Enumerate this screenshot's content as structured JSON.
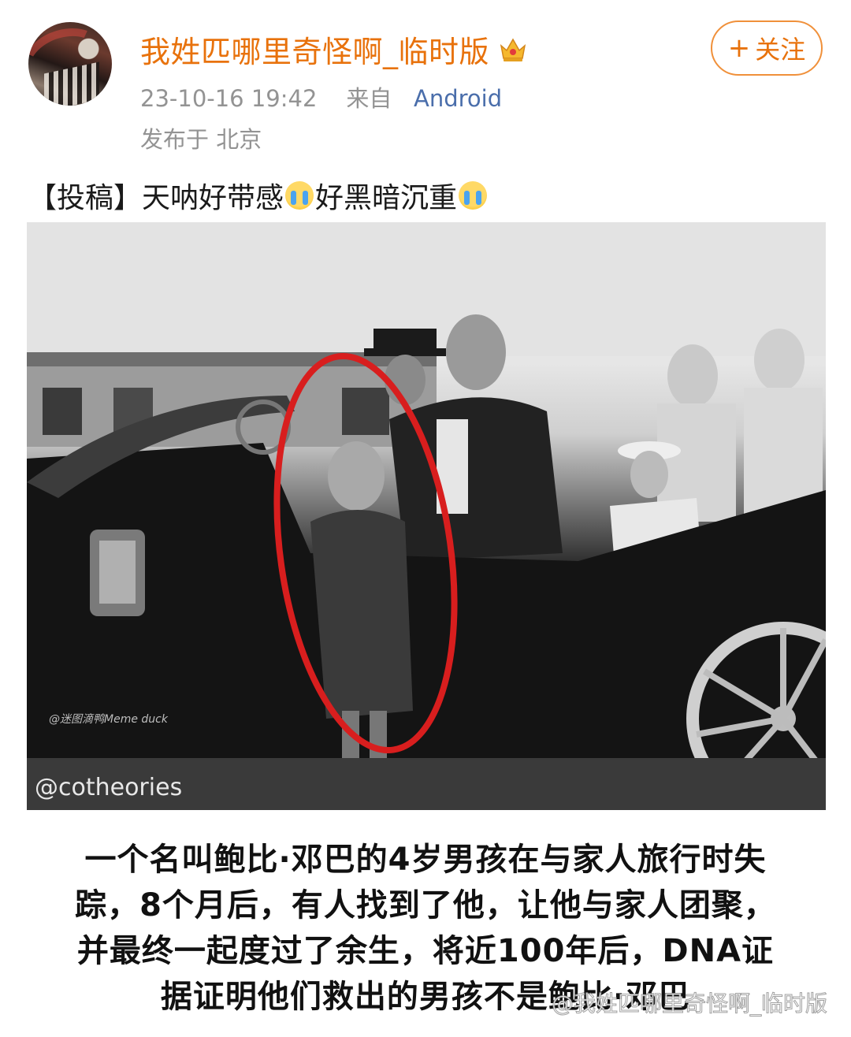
{
  "post": {
    "username": "我姓匹哪里奇怪啊_临时版",
    "timestamp": "23-10-16 19:42",
    "source_prefix": "来自",
    "source": "Android",
    "location": "发布于 北京",
    "follow_label": "关注",
    "follow_icon": "plus-icon",
    "badge_icon": "crown-icon",
    "text_prefix": "【投稿】天呐好带感",
    "text_middle": "好黑暗沉重",
    "emoji_icon": "crying-emoji"
  },
  "image": {
    "watermark_cotheories": "@cotheories",
    "watermark_meme": "@迷图滴鸭Meme duck",
    "caption_lines": [
      "一个名叫鲍比·邓巴的4岁男孩在与家人旅行时失",
      "踪，8个月后，有人找到了他，让他与家人团聚，",
      "并最终一起度过了余生，将近100年后，DNA证",
      "据证明他们救出的男孩不是鲍比·邓巴"
    ],
    "site_watermark": "@我姓匹哪里奇怪啊_临时版"
  },
  "colors": {
    "username": "#e8720c",
    "meta": "#939393",
    "source_link": "#4a6eab",
    "follow_border": "#f0903a",
    "highlight_circle": "#d81e1e"
  }
}
